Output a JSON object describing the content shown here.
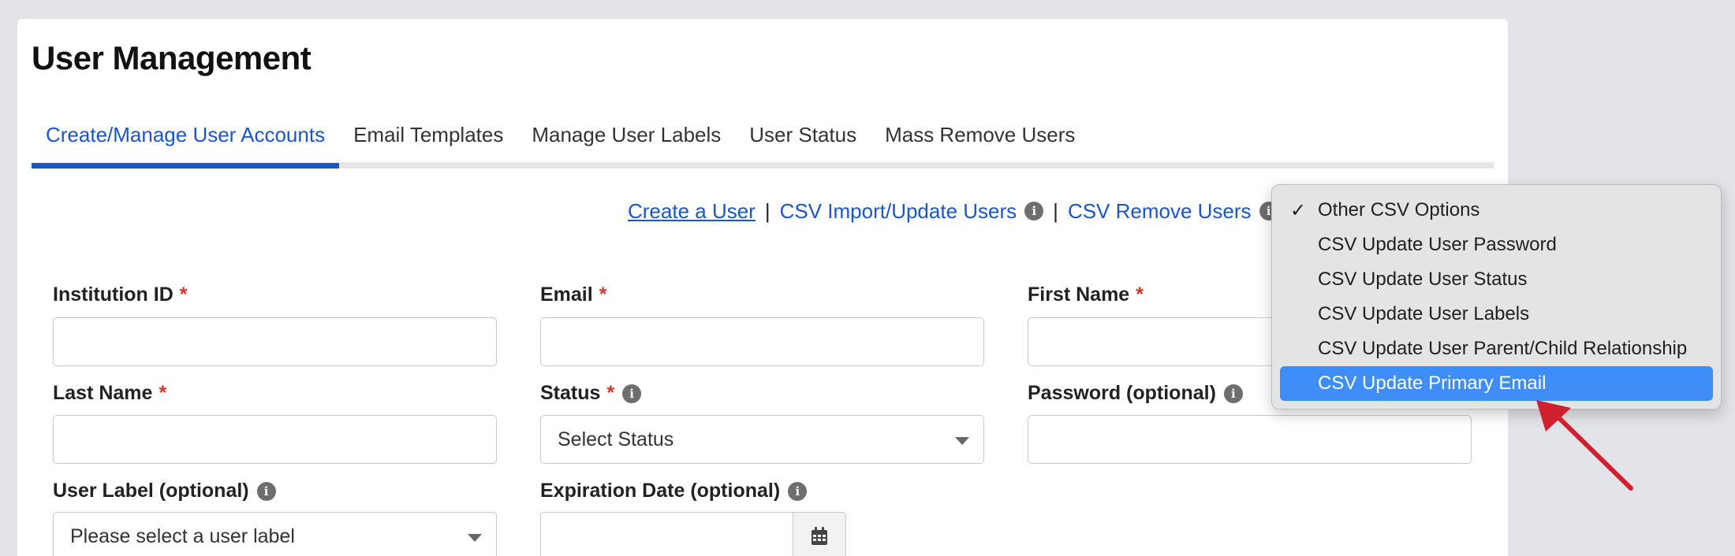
{
  "header": {
    "title": "User Management"
  },
  "tabs": [
    {
      "label": "Create/Manage User Accounts",
      "active": true
    },
    {
      "label": "Email Templates"
    },
    {
      "label": "Manage User Labels"
    },
    {
      "label": "User Status"
    },
    {
      "label": "Mass Remove Users"
    }
  ],
  "actions": {
    "create_user": "Create a User",
    "separator": "|",
    "csv_import": "CSV Import/Update Users",
    "csv_remove": "CSV Remove Users"
  },
  "form": {
    "required_mark": "*",
    "institution_id": {
      "label": "Institution ID",
      "value": ""
    },
    "email": {
      "label": "Email",
      "value": ""
    },
    "first_name": {
      "label": "First Name",
      "value": ""
    },
    "last_name": {
      "label": "Last Name",
      "value": ""
    },
    "status": {
      "label": "Status",
      "value": "Select Status"
    },
    "password": {
      "label": "Password (optional)",
      "value": ""
    },
    "user_label": {
      "label": "User Label (optional)",
      "value": "Please select a user label"
    },
    "expiration_date": {
      "label": "Expiration Date (optional)",
      "value": ""
    }
  },
  "csv_options": {
    "check_mark": "✓",
    "items": [
      {
        "label": "Other CSV Options",
        "checked": true
      },
      {
        "label": "CSV Update User Password"
      },
      {
        "label": "CSV Update User Status"
      },
      {
        "label": "CSV Update User Labels"
      },
      {
        "label": "CSV Update User Parent/Child Relationship"
      },
      {
        "label": "CSV Update Primary Email",
        "highlighted": true
      }
    ]
  },
  "colors": {
    "accent": "#1a56c9",
    "required": "#d9342b",
    "highlight": "#3f8ef7",
    "annotation_arrow": "#d0202e"
  },
  "icons": {
    "info": "info-icon",
    "calendar": "calendar-icon",
    "check": "check-icon",
    "caret": "chevron-down-icon"
  }
}
